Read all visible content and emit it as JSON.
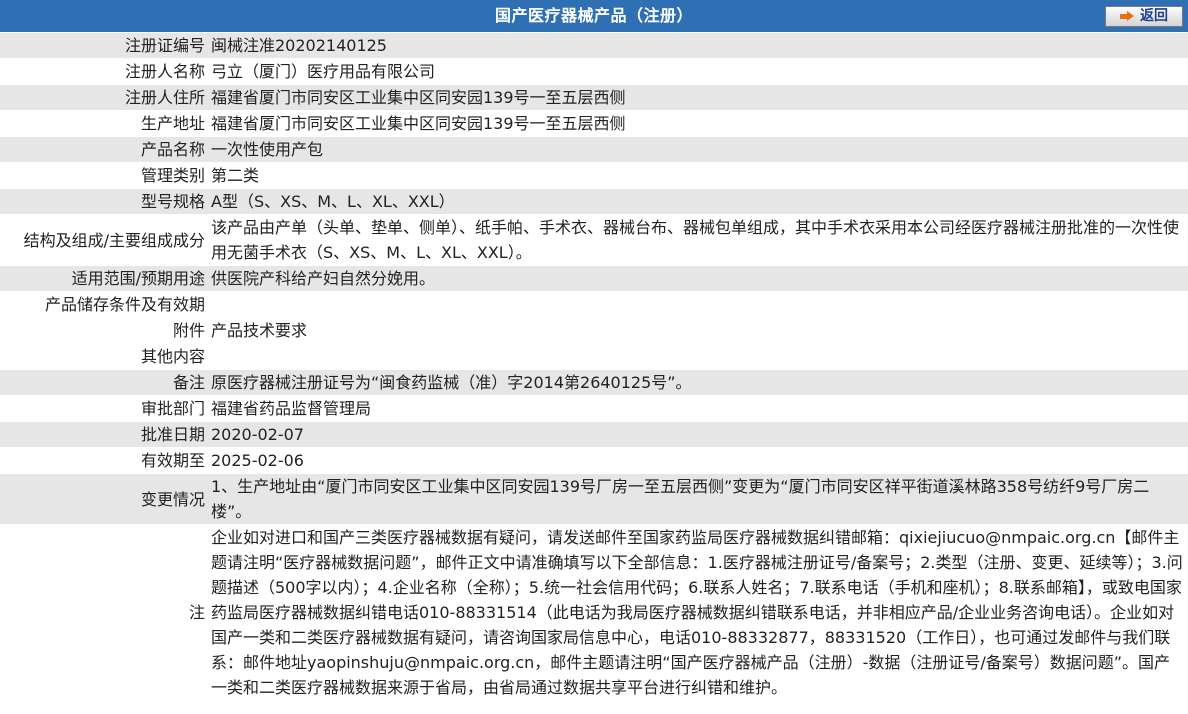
{
  "header": {
    "title": "国产医疗器械产品（注册）",
    "back_label": "返回"
  },
  "fields": {
    "reg_no": {
      "label": "注册证编号",
      "value": "闽械注准20202140125"
    },
    "registrant": {
      "label": "注册人名称",
      "value": "弓立（厦门）医疗用品有限公司"
    },
    "registrant_address": {
      "label": "注册人住所",
      "value": "福建省厦门市同安区工业集中区同安园139号一至五层西侧"
    },
    "production_address": {
      "label": "生产地址",
      "value": "福建省厦门市同安区工业集中区同安园139号一至五层西侧"
    },
    "product_name": {
      "label": "产品名称",
      "value": "一次性使用产包"
    },
    "category": {
      "label": "管理类别",
      "value": "第二类"
    },
    "model": {
      "label": "型号规格",
      "value": "A型（S、XS、M、L、XL、XXL）"
    },
    "structure": {
      "label": "结构及组成/主要组成成分",
      "value": "该产品由产单（头单、垫单、侧单）、纸手帕、手术衣、器械台布、器械包单组成，其中手术衣采用本公司经医疗器械注册批准的一次性使用无菌手术衣（S、XS、M、L、XL、XXL）。"
    },
    "scope": {
      "label": "适用范围/预期用途",
      "value": "供医院产科给产妇自然分娩用。"
    },
    "storage": {
      "label": "产品储存条件及有效期",
      "value": ""
    },
    "attachment": {
      "label": "附件",
      "value": "产品技术要求"
    },
    "other": {
      "label": "其他内容",
      "value": ""
    },
    "remark": {
      "label": "备注",
      "value": "原医疗器械注册证号为“闽食药监械（准）字2014第2640125号”。"
    },
    "approval_dept": {
      "label": "审批部门",
      "value": "福建省药品监督管理局"
    },
    "approval_date": {
      "label": "批准日期",
      "value": "2020-02-07"
    },
    "valid_until": {
      "label": "有效期至",
      "value": "2025-02-06"
    },
    "changes": {
      "label": "变更情况",
      "value": "1、生产地址由“厦门市同安区工业集中区同安园139号厂房一至五层西侧”变更为“厦门市同安区祥平街道溪林路358号纺纤9号厂房二楼”。"
    },
    "note": {
      "label": "注",
      "value": "企业如对进口和国产三类医疗器械数据有疑问，请发送邮件至国家药监局医疗器械数据纠错邮箱：qixiejiucuo@nmpaic.org.cn【邮件主题请注明“医疗器械数据问题”，邮件正文中请准确填写以下全部信息：1.医疗器械注册证号/备案号；2.类型（注册、变更、延续等）；3.问题描述（500字以内）；4.企业名称（全称）；5.统一社会信用代码；6.联系人姓名；7.联系电话（手机和座机）；8.联系邮箱】，或致电国家药监局医疗器械数据纠错电话010-88331514（此电话为我局医疗器械数据纠错联系电话，并非相应产品/企业业务咨询电话）。企业如对国产一类和二类医疗器械数据有疑问，请咨询国家局信息中心，电话010-88332877，88331520（工作日），也可通过发邮件与我们联系：邮件地址yaopinshuju@nmpaic.org.cn，邮件主题请注明“国产医疗器械产品（注册）-数据（注册证号/备案号）数据问题”。国产一类和二类医疗器械数据来源于省局，由省局通过数据共享平台进行纠错和维护。"
    }
  },
  "colors": {
    "header_bg": "#2f6fb3",
    "row_shade": "#e6e6e6",
    "row_plain": "#ffffff",
    "back_text": "#1f3f8a",
    "arrow": "#e8710a"
  },
  "icons": {
    "back": "arrow-right-icon"
  }
}
